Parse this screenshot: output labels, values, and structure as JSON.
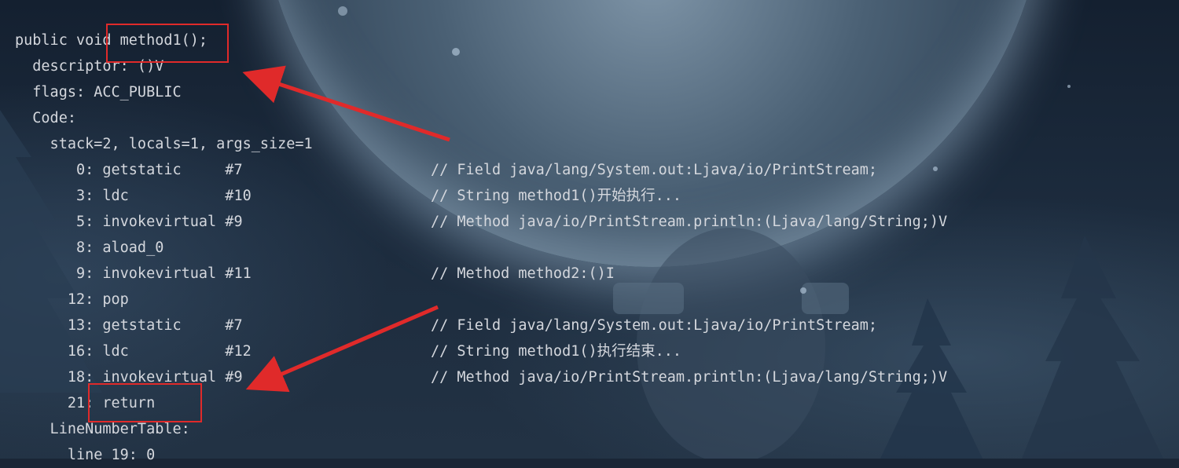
{
  "code": {
    "lines": [
      {
        "text": "public void method1();",
        "comment": ""
      },
      {
        "text": "  descriptor: ()V",
        "comment": ""
      },
      {
        "text": "  flags: ACC_PUBLIC",
        "comment": ""
      },
      {
        "text": "  Code:",
        "comment": ""
      },
      {
        "text": "    stack=2, locals=1, args_size=1",
        "comment": ""
      },
      {
        "text": "       0: getstatic     #7",
        "comment": "// Field java/lang/System.out:Ljava/io/PrintStream;"
      },
      {
        "text": "       3: ldc           #10",
        "comment": "// String method1()开始执行..."
      },
      {
        "text": "       5: invokevirtual #9",
        "comment": "// Method java/io/PrintStream.println:(Ljava/lang/String;)V"
      },
      {
        "text": "       8: aload_0",
        "comment": ""
      },
      {
        "text": "       9: invokevirtual #11",
        "comment": "// Method method2:()I"
      },
      {
        "text": "      12: pop",
        "comment": ""
      },
      {
        "text": "      13: getstatic     #7",
        "comment": "// Field java/lang/System.out:Ljava/io/PrintStream;"
      },
      {
        "text": "      16: ldc           #12",
        "comment": "// String method1()执行结束..."
      },
      {
        "text": "      18: invokevirtual #9",
        "comment": "// Method java/io/PrintStream.println:(Ljava/lang/String;)V"
      },
      {
        "text": "      21: return",
        "comment": ""
      },
      {
        "text": "    LineNumberTable:",
        "comment": ""
      },
      {
        "text": "      line 19: 0",
        "comment": ""
      }
    ]
  },
  "annotations": {
    "color": "#e02a2a"
  }
}
